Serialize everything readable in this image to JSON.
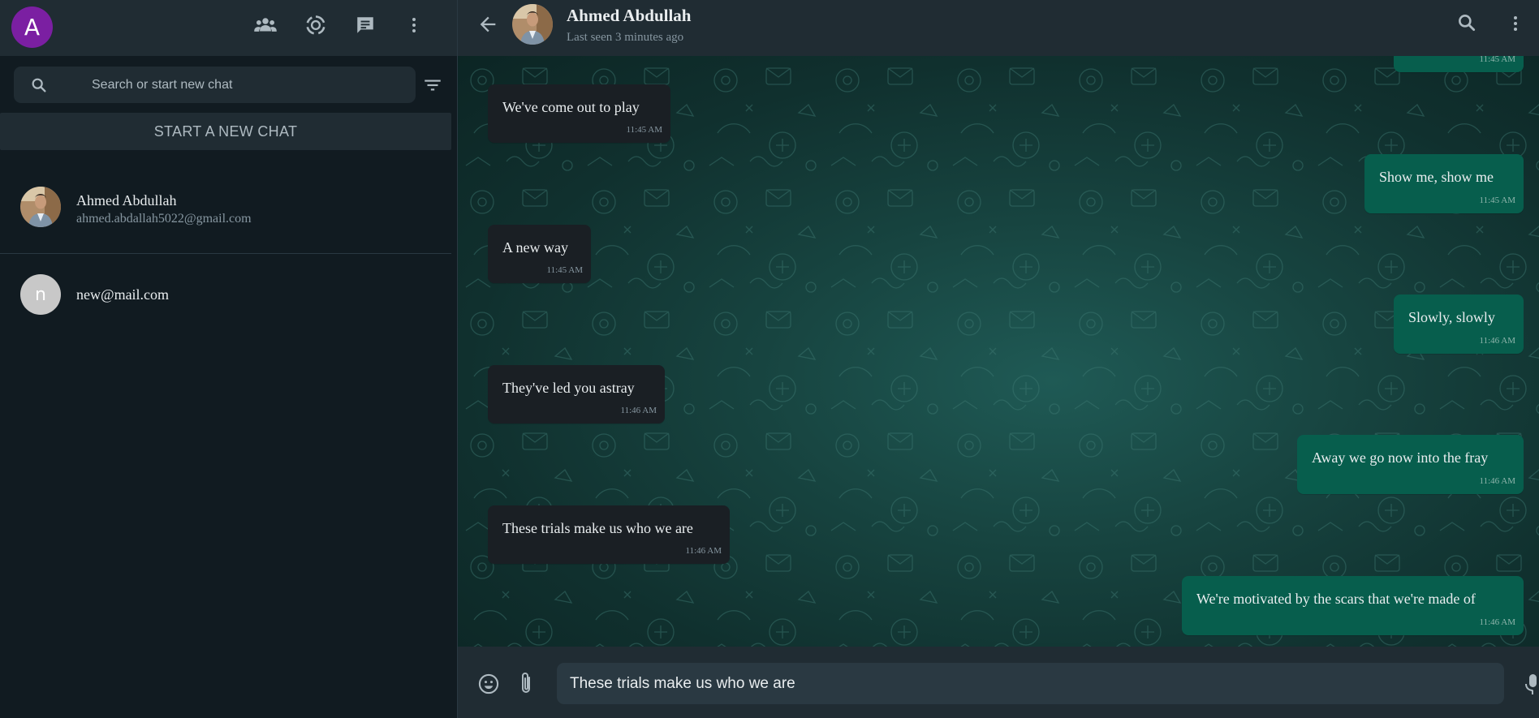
{
  "sidebar": {
    "user_initial": "A",
    "header_icons": [
      "community-icon",
      "status-icon",
      "new-chat-icon",
      "menu-icon"
    ],
    "search": {
      "placeholder": "Search or start new chat",
      "value": ""
    },
    "new_chat_label": "START A NEW CHAT",
    "contacts": [
      {
        "name": "Ahmed Abdullah",
        "subtitle": "ahmed.abdallah5022@gmail.com",
        "avatar": "photo"
      },
      {
        "name": "new@mail.com",
        "subtitle": "",
        "avatar_initial": "n"
      }
    ]
  },
  "chat": {
    "contact_name": "Ahmed Abdullah",
    "last_seen": "Last seen 3 minutes ago",
    "messages": [
      {
        "direction": "out",
        "text": "",
        "time": "11:45 AM"
      },
      {
        "direction": "in",
        "text": "We've come out to play",
        "time": "11:45 AM"
      },
      {
        "direction": "out",
        "text": "Show me, show me",
        "time": "11:45 AM"
      },
      {
        "direction": "in",
        "text": "A new way",
        "time": "11:45 AM"
      },
      {
        "direction": "out",
        "text": "Slowly, slowly",
        "time": "11:46 AM"
      },
      {
        "direction": "in",
        "text": "They've led you astray",
        "time": "11:46 AM"
      },
      {
        "direction": "out",
        "text": "Away we go now into the fray",
        "time": "11:46 AM"
      },
      {
        "direction": "in",
        "text": "These trials make us who we are",
        "time": "11:46 AM"
      },
      {
        "direction": "out",
        "text": "We're motivated by the scars that we're made of",
        "time": "11:46 AM"
      }
    ],
    "composer_value": "These trials make us who we are"
  },
  "colors": {
    "panel": "#111b21",
    "header": "#202c33",
    "incoming_bubble": "#1a1f24",
    "outgoing_bubble": "#075e4d",
    "avatar_purple": "#7b1fa2"
  }
}
